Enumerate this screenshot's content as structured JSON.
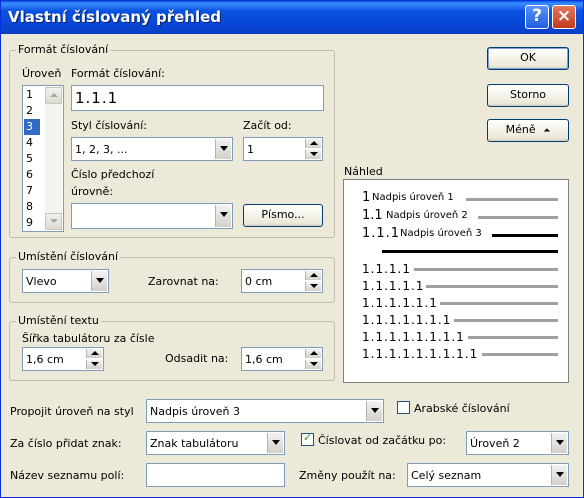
{
  "window": {
    "title": "Vlastní číslovaný přehled",
    "help_glyph": "?",
    "close_glyph": "×"
  },
  "format_group": {
    "title": "Formát číslování",
    "level_label": "Úroveň",
    "levels": [
      "1",
      "2",
      "3",
      "4",
      "5",
      "6",
      "7",
      "8",
      "9"
    ],
    "selected_level": "3",
    "format_label": "Formát číslování:",
    "format_value": "1.1.1",
    "style_label": "Styl číslování:",
    "style_value": "1, 2, 3, ...",
    "start_label": "Začít od:",
    "start_value": "1",
    "prev_level_label_line1": "Číslo předchozí",
    "prev_level_label_line2": "úrovně:",
    "prev_level_value": "",
    "font_button": "Písmo..."
  },
  "buttons": {
    "ok": "OK",
    "cancel": "Storno",
    "less": "Méně",
    "less_icon": "⏶"
  },
  "preview": {
    "title": "Náhled",
    "headings": [
      {
        "num": "1",
        "text": "Nadpis úroveň 1"
      },
      {
        "num": "1.1",
        "text": "Nadpis úroveň 2"
      },
      {
        "num": "1.1.1",
        "text": "Nadpis úroveň 3"
      }
    ],
    "numbers": [
      "1.1.1.1",
      "1.1.1.1.1",
      "1.1.1.1.1.1",
      "1.1.1.1.1.1.1",
      "1.1.1.1.1.1.1.1",
      "1.1.1.1.1.1.1.1.1"
    ]
  },
  "number_position": {
    "title": "Umístění číslování",
    "align_value": "Vlevo",
    "aligned_at_label": "Zarovnat na:",
    "aligned_at_value": "0 cm"
  },
  "text_position": {
    "title": "Umístění textu",
    "tab_width_label": "Šířka tabulátoru za čísle",
    "tab_width_value": "1,6 cm",
    "indent_label": "Odsadit na:",
    "indent_value": "1,6 cm"
  },
  "bottom": {
    "link_label": "Propojit úroveň na styl",
    "link_value": "Nadpis úroveň 3",
    "arabic_label": "Arabské číslování",
    "follow_label": "Za číslo přidat znak:",
    "follow_value": "Znak tabulátoru",
    "restart_label": "Číslovat od začátku po:",
    "restart_value": "Úroveň 2",
    "field_label": "Název seznamu polí:",
    "field_value": "",
    "apply_label": "Změny použít na:",
    "apply_value": "Celý seznam"
  }
}
